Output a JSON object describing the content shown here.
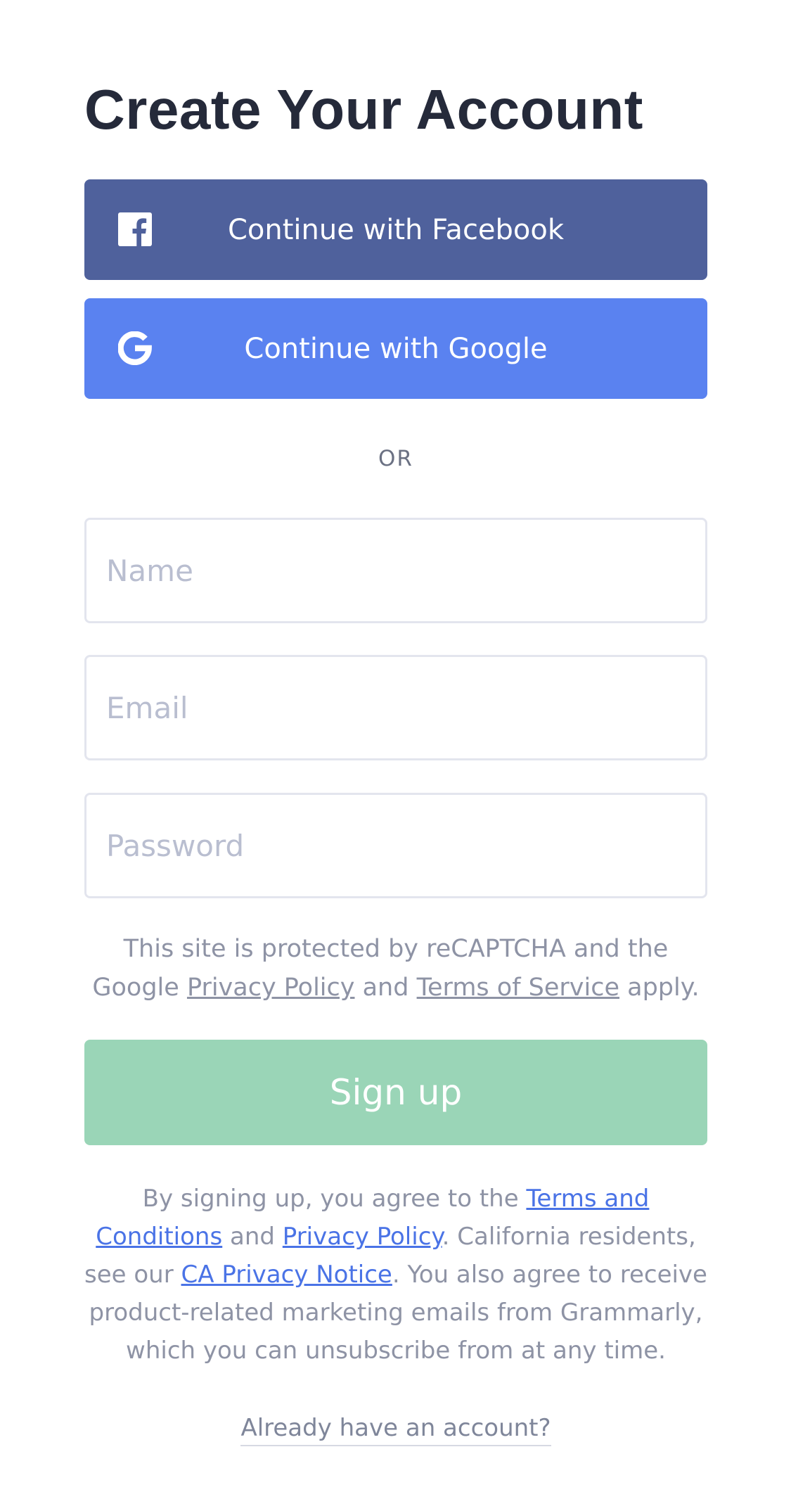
{
  "page": {
    "title": "Create Your Account"
  },
  "social": {
    "facebook_label": "Continue with Facebook",
    "google_label": "Continue with Google"
  },
  "divider": "OR",
  "form": {
    "name_placeholder": "Name",
    "email_placeholder": "Email",
    "password_placeholder": "Password"
  },
  "recaptcha": {
    "text_1": "This site is protected by reCAPTCHA and the Google ",
    "privacy_link": "Privacy Policy",
    "text_2": " and ",
    "terms_link": "Terms of Service",
    "text_3": " apply."
  },
  "signup_label": "Sign up",
  "terms": {
    "text_1": "By signing up, you agree to the ",
    "terms_link": "Terms and Conditions",
    "text_2": " and ",
    "privacy_link": "Privacy Policy",
    "text_3": ". California residents, see our ",
    "ca_link": "CA Privacy Notice",
    "text_4": ". You also agree to receive product-related marketing emails from Grammarly, which you can unsubscribe from at any time."
  },
  "login_link": "Already have an account?",
  "colors": {
    "facebook": "#4f619c",
    "google": "#5a82f0",
    "signup": "#9ad5b7",
    "link": "#4a73e6"
  },
  "icons": {
    "facebook": "facebook-icon",
    "google": "google-icon"
  }
}
